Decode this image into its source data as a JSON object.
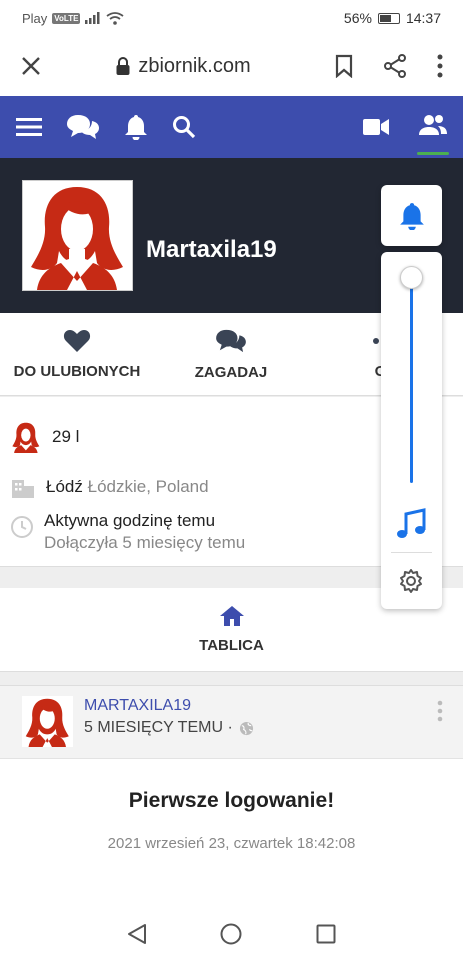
{
  "status_bar": {
    "carrier": "Play",
    "volte": "VoLTE",
    "battery": "56%",
    "battery_level": 0.56,
    "time": "14:37"
  },
  "browser": {
    "url": "zbiornik.com"
  },
  "nav": {
    "icons": [
      "menu-icon",
      "chat-icon",
      "bell-icon",
      "search-icon",
      "video-icon",
      "friends-icon"
    ],
    "accent": "#3d4dad",
    "active_indicator": "#4caf50"
  },
  "profile": {
    "username": "Martaxila19",
    "actions": [
      {
        "label": "DO ULUBIONYCH",
        "icon": "heart-icon"
      },
      {
        "label": "ZAGADAJ",
        "icon": "chat-icon"
      },
      {
        "label": "OP",
        "icon": "more-icon"
      }
    ],
    "age": "29 l",
    "city": "Łódź",
    "region": "Łódzkie, Poland",
    "activity": "Aktywna godzinę temu",
    "joined": "Dołączyła 5 miesięcy temu"
  },
  "tabs": {
    "active": "TABLICA"
  },
  "post": {
    "author": "MARTAXILA19",
    "time": "5 MIESIĘCY TEMU ·",
    "title": "Pierwsze logowanie!",
    "date": "2021 wrzesień 23, czwartek 18:42:08"
  }
}
